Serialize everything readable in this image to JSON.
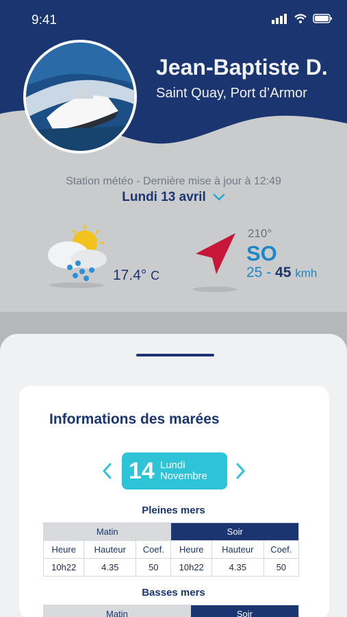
{
  "status_bar": {
    "time": "9:41"
  },
  "profile": {
    "name": "Jean-Baptiste D.",
    "location": "Saint Quay, Port d’Armor"
  },
  "weather": {
    "station_update": "Station météo - Dernière mise à jour à 12:49",
    "date": "Lundi 13 avril",
    "condition_icon": "sun-cloud-rain-icon",
    "temperature": "17.4°",
    "temperature_unit": "C",
    "wind_icon": "wind-direction-arrow-icon",
    "wind_degrees": "210°",
    "wind_direction": "SO",
    "wind_speed_min": "25 -",
    "wind_speed_max": "45",
    "wind_speed_unit": "kmh"
  },
  "tides": {
    "title": "Informations des marées",
    "day_number": "14",
    "day_name": "Lundi",
    "month": "Novembre",
    "high_tides": {
      "title": "Pleines mers",
      "morning_label": "Matin",
      "evening_label": "Soir",
      "columns": [
        "Heure",
        "Hauteur",
        "Coef.",
        "Heure",
        "Hauteur",
        "Coef."
      ],
      "values": [
        "10h22",
        "4.35",
        "50",
        "10h22",
        "4.35",
        "50"
      ]
    },
    "low_tides": {
      "title": "Basses mers",
      "morning_label": "Matin",
      "evening_label": "Soir"
    }
  },
  "colors": {
    "navy": "#1a3570",
    "accent_cyan": "#2ec4d8",
    "wind_blue": "#1d87c8",
    "arrow_red": "#c8183a"
  }
}
